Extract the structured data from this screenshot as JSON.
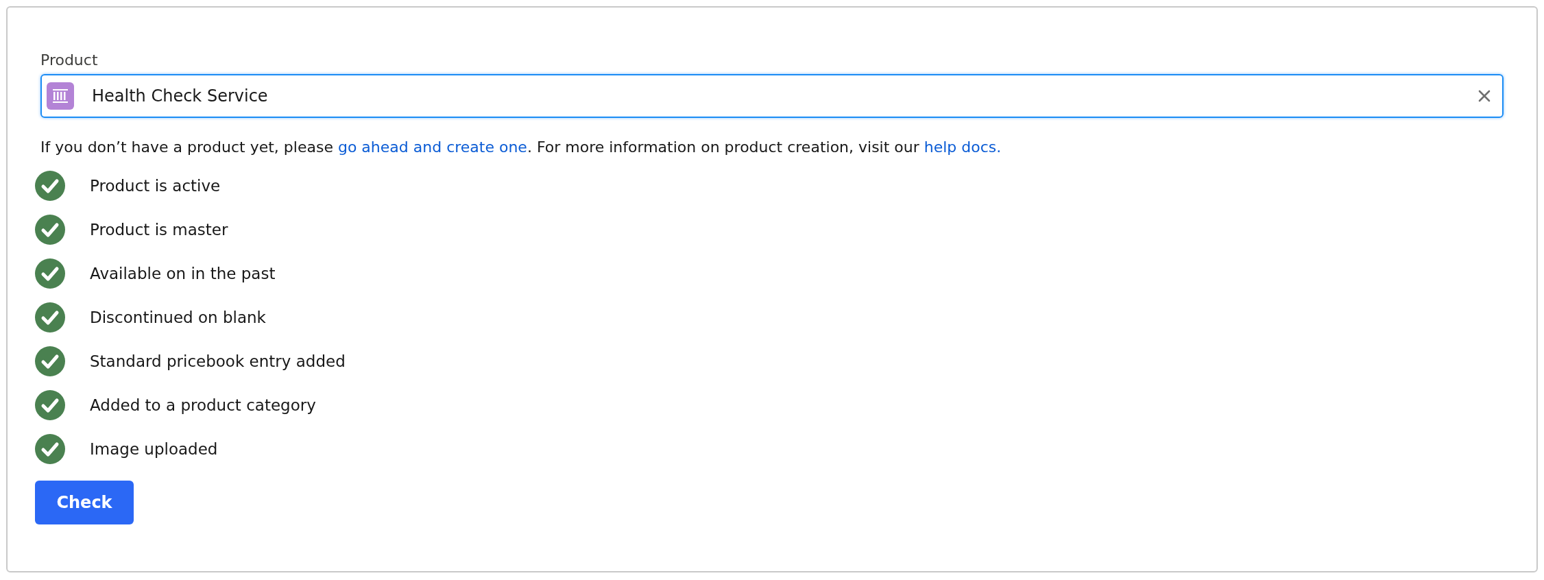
{
  "product_field": {
    "label": "Product",
    "value": "Health Check Service"
  },
  "help_text": [
    {
      "kind": "text",
      "text": "If you don’t have a product yet, please "
    },
    {
      "kind": "link",
      "text": "go ahead and create one"
    },
    {
      "kind": "text",
      "text": ". For more information on product creation, visit our "
    },
    {
      "kind": "link",
      "text": "help docs."
    }
  ],
  "checks": [
    {
      "label": "Product is active",
      "passed": true
    },
    {
      "label": "Product is master",
      "passed": true
    },
    {
      "label": "Available on in the past",
      "passed": true
    },
    {
      "label": "Discontinued on blank",
      "passed": true
    },
    {
      "label": "Standard pricebook entry added",
      "passed": true
    },
    {
      "label": "Added to a product category",
      "passed": true
    },
    {
      "label": "Image uploaded",
      "passed": true
    }
  ],
  "button": "Check"
}
